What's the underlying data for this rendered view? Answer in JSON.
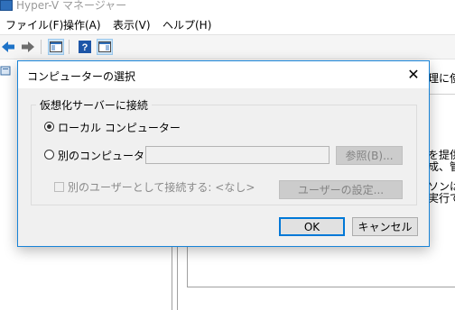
{
  "app": {
    "title": "Hyper-V マネージャー"
  },
  "menu": [
    "ファイル(F)",
    "操作(A)",
    "表示(V)",
    "ヘルプ(H)"
  ],
  "toolbar": {
    "back_icon": "back-arrow-icon",
    "forward_icon": "forward-arrow-icon",
    "console_tree_icon": "console-tree-icon",
    "help_icon": "help-icon",
    "action_pane_icon": "action-pane-icon"
  },
  "background_right": {
    "line1": "理に使",
    "line2": "を提供",
    "line3": "成、管",
    "line4": "ソンは",
    "line5": "実行で"
  },
  "dialog": {
    "title": "コンピューターの選択",
    "close_label": "✕",
    "group_label": "仮想化サーバーに接続",
    "local_label": "ローカル コンピューター",
    "other_label": "別のコンピューター:",
    "browse_label": "参照(B)...",
    "connect_as_label": "別のユーザーとして接続する: <なし>",
    "set_user_label": "ユーザーの設定...",
    "ok_label": "OK",
    "cancel_label": "キャンセル"
  },
  "colors": {
    "accent": "#0078d7",
    "dialog_border": "#1883d7"
  }
}
